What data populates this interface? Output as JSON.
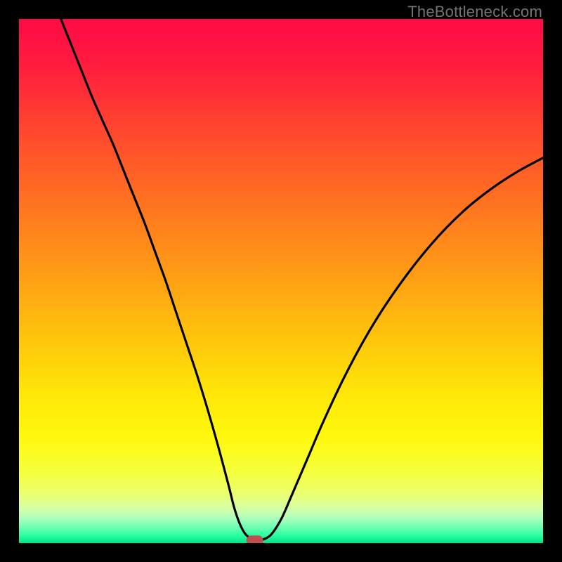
{
  "watermark": "TheBottleneck.com",
  "colors": {
    "gradient_stops": [
      {
        "offset": 0.0,
        "color": "#ff0b46"
      },
      {
        "offset": 0.08,
        "color": "#ff1a3f"
      },
      {
        "offset": 0.2,
        "color": "#ff4330"
      },
      {
        "offset": 0.35,
        "color": "#ff7220"
      },
      {
        "offset": 0.5,
        "color": "#ffa114"
      },
      {
        "offset": 0.62,
        "color": "#ffc80b"
      },
      {
        "offset": 0.72,
        "color": "#ffe808"
      },
      {
        "offset": 0.8,
        "color": "#fff90e"
      },
      {
        "offset": 0.86,
        "color": "#f6ff38"
      },
      {
        "offset": 0.905,
        "color": "#ecff6e"
      },
      {
        "offset": 0.935,
        "color": "#d4ffa9"
      },
      {
        "offset": 0.955,
        "color": "#a6ffbd"
      },
      {
        "offset": 0.97,
        "color": "#6dffb1"
      },
      {
        "offset": 0.985,
        "color": "#2bffa1"
      },
      {
        "offset": 1.0,
        "color": "#00e48a"
      }
    ],
    "curve": "#000000",
    "marker_fill": "#bf504f",
    "frame": "#000000"
  },
  "chart_data": {
    "type": "line",
    "title": "",
    "xlabel": "",
    "ylabel": "",
    "xlim": [
      0,
      100
    ],
    "ylim": [
      0,
      100
    ],
    "series": [
      {
        "name": "bottleneck-curve",
        "x": [
          8,
          10,
          12,
          14,
          16,
          18,
          20,
          22,
          24,
          26,
          28,
          30,
          32,
          34,
          36,
          38,
          40,
          41,
          42,
          43,
          44,
          45,
          46,
          48,
          50,
          52,
          55,
          58,
          62,
          66,
          70,
          75,
          80,
          85,
          90,
          95,
          100
        ],
        "y": [
          100,
          95,
          90,
          85,
          80.5,
          76,
          71,
          66,
          61,
          55.5,
          50,
          44,
          38,
          32,
          25.5,
          18.5,
          11,
          7,
          4,
          2,
          1,
          0.6,
          0.5,
          1.5,
          4.5,
          9,
          16,
          23,
          31.5,
          39,
          45.5,
          52.5,
          58.5,
          63.5,
          67.5,
          70.8,
          73.5
        ]
      }
    ],
    "marker": {
      "x": 45,
      "y": 0.5
    }
  }
}
